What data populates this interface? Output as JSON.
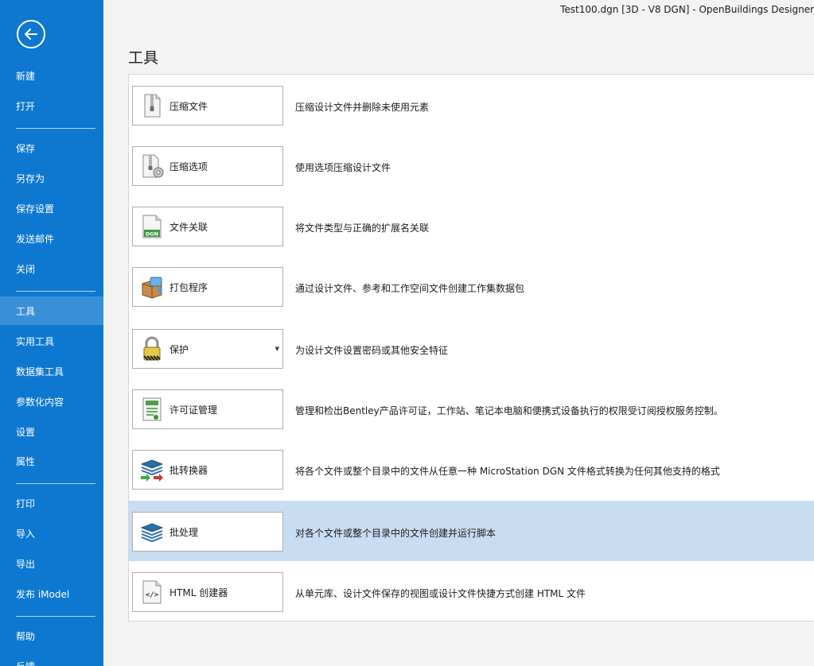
{
  "window": {
    "title": "Test100.dgn [3D - V8 DGN] - OpenBuildings Designer"
  },
  "sidebar": {
    "items": [
      {
        "label": "新建"
      },
      {
        "label": "打开"
      },
      {
        "label": "保存"
      },
      {
        "label": "另存为"
      },
      {
        "label": "保存设置"
      },
      {
        "label": "发送邮件"
      },
      {
        "label": "关闭"
      },
      {
        "label": "工具",
        "active": true
      },
      {
        "label": "实用工具"
      },
      {
        "label": "数据集工具"
      },
      {
        "label": "参数化内容"
      },
      {
        "label": "设置"
      },
      {
        "label": "属性"
      },
      {
        "label": "打印"
      },
      {
        "label": "导入"
      },
      {
        "label": "导出"
      },
      {
        "label": "发布 iModel"
      },
      {
        "label": "帮助"
      },
      {
        "label": "反馈"
      }
    ]
  },
  "main": {
    "heading": "工具",
    "tools": [
      {
        "label": "压缩文件",
        "description": "压缩设计文件并删除未使用元素",
        "icon": "zip-file-icon"
      },
      {
        "label": "压缩选项",
        "description": "使用选项压缩设计文件",
        "icon": "zip-options-icon"
      },
      {
        "label": "文件关联",
        "description": "将文件类型与正确的扩展名关联",
        "icon": "dgn-file-icon",
        "icon_text": "DGN"
      },
      {
        "label": "打包程序",
        "description": "通过设计文件、参考和工作空间文件创建工作集数据包",
        "icon": "package-icon"
      },
      {
        "label": "保护",
        "description": "为设计文件设置密码或其他安全特征",
        "icon": "padlock-icon",
        "has_dropdown": true
      },
      {
        "label": "许可证管理",
        "description": "管理和检出Bentley产品许可证，工作站、笔记本电脑和便携式设备执行的权限受订阅授权服务控制。",
        "icon": "license-icon"
      },
      {
        "label": "批转换器",
        "description": "将各个文件或整个目录中的文件从任意一种 MicroStation DGN 文件格式转换为任何其他支持的格式",
        "icon": "batch-convert-icon"
      },
      {
        "label": "批处理",
        "description": "对各个文件或整个目录中的文件创建并运行脚本",
        "icon": "batch-process-icon",
        "selected": true
      },
      {
        "label": "HTML 创建器",
        "description": "从单元库、设计文件保存的视图或设计文件快捷方式创建 HTML 文件",
        "icon": "html-file-icon",
        "icon_text": "</>"
      }
    ]
  },
  "colors": {
    "sidebar": "#0e78d0",
    "sidebar_active": "#3a90d8",
    "row_selected": "#c8dcf2"
  }
}
